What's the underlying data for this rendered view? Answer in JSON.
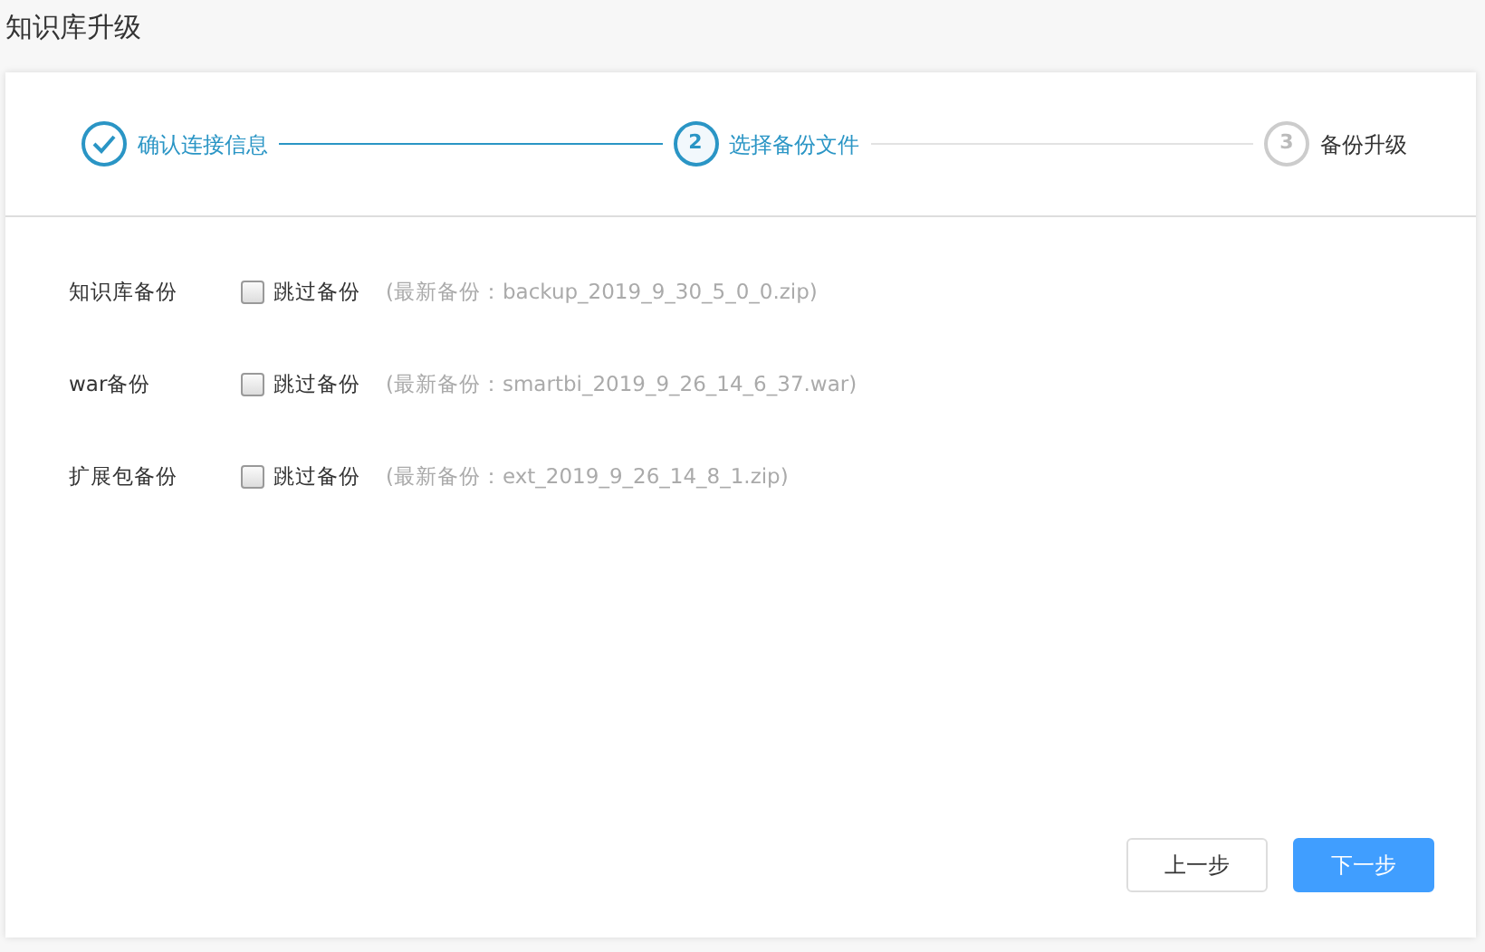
{
  "page_title": "知识库升级",
  "steps": [
    {
      "label": "确认连接信息",
      "completed": true,
      "selected": false
    },
    {
      "label": "选择备份文件",
      "number": "2",
      "completed": false,
      "selected": true
    },
    {
      "label": "备份升级",
      "number": "3",
      "completed": false,
      "selected": false
    }
  ],
  "backups": [
    {
      "label": "知识库备份",
      "skip_label": "跳过备份",
      "checked": false,
      "latest": "(最新备份：backup_2019_9_30_5_0_0.zip)"
    },
    {
      "label": "war备份",
      "skip_label": "跳过备份",
      "checked": false,
      "latest": "(最新备份：smartbi_2019_9_26_14_6_37.war)"
    },
    {
      "label": "扩展包备份",
      "skip_label": "跳过备份",
      "checked": false,
      "latest": "(最新备份：ext_2019_9_26_14_8_1.zip)"
    }
  ],
  "buttons": [
    {
      "label": "上一步",
      "kind": "secondary"
    },
    {
      "label": "下一步",
      "kind": "primary"
    }
  ]
}
